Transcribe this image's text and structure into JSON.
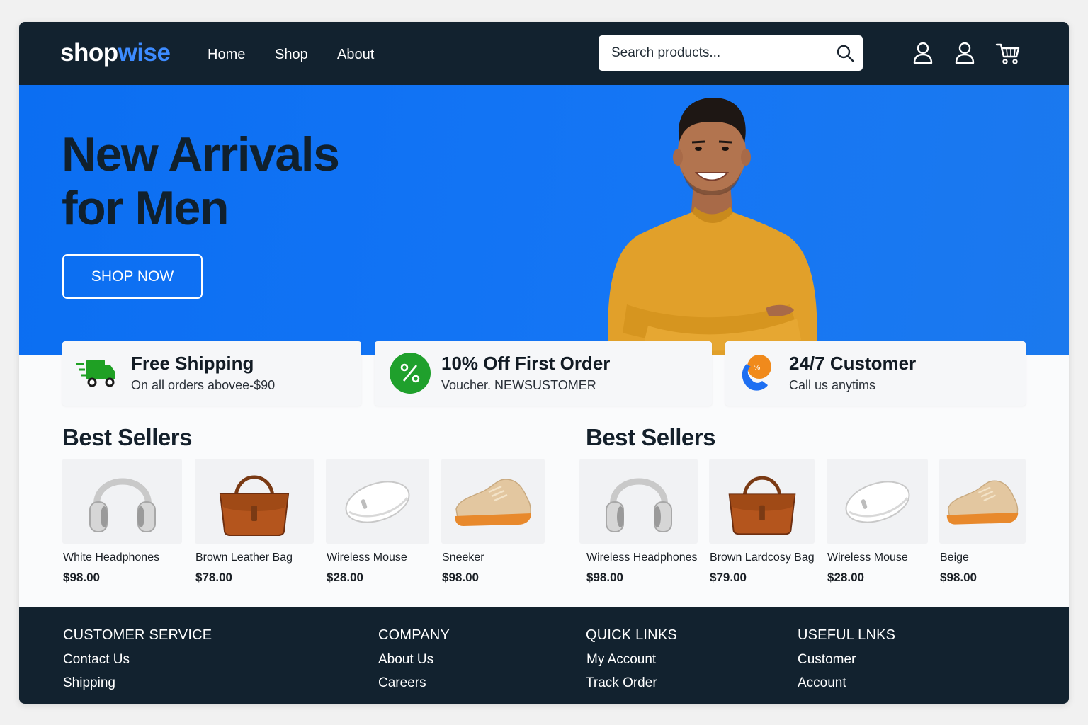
{
  "header": {
    "logo_main": "shop",
    "logo_accent": "wise",
    "nav": [
      "Home",
      "Shop",
      "About"
    ],
    "search_placeholder": "Search products..."
  },
  "hero": {
    "title_line1": "New Arrivals",
    "title_line2": "for Men",
    "cta_label": "SHOP NOW"
  },
  "features": [
    {
      "title": "Free Shipping",
      "subtitle": "On all orders abovee-$90",
      "icon": "delivery-truck-icon",
      "color": "#1fa024"
    },
    {
      "title": "10% Off First Order",
      "subtitle": "Voucher. NEWSUSTOMER",
      "icon": "percent-badge-icon",
      "color": "#1fa02c"
    },
    {
      "title": "24/7 Customer",
      "subtitle": "Call us anytims",
      "icon": "support-phone-icon",
      "color": "#f08a1c"
    }
  ],
  "best_sellers": [
    {
      "title": "Best Sellers",
      "products": [
        {
          "name": "White Headphones",
          "price": "$98.00",
          "icon": "headphones-image"
        },
        {
          "name": "Brown Leather Bag",
          "price": "$78.00",
          "icon": "leather-bag-image"
        },
        {
          "name": "Wireless Mouse",
          "price": "$28.00",
          "icon": "mouse-image"
        },
        {
          "name": "Sneeker",
          "price": "$98.00",
          "icon": "sneaker-image"
        }
      ]
    },
    {
      "title": "Best Sellers",
      "products": [
        {
          "name": "Wireless Headphones",
          "price": "$98.00",
          "icon": "headphones-image"
        },
        {
          "name": "Brown Lardcosy Bag",
          "price": "$79.00",
          "icon": "leather-bag-image"
        },
        {
          "name": "Wireless Mouse",
          "price": "$28.00",
          "icon": "mouse-image"
        },
        {
          "name": "Beige",
          "price": "$98.00",
          "icon": "sneaker-image"
        }
      ]
    }
  ],
  "footer": [
    {
      "heading": "CUSTOMER SERVICE",
      "links": [
        "Contact Us",
        "Shipping"
      ]
    },
    {
      "heading": "COMPANY",
      "links": [
        "About Us",
        "Careers"
      ]
    },
    {
      "heading": "QUICK LINKS",
      "links": [
        "My Account",
        "Track Order"
      ]
    },
    {
      "heading": "USEFUL LNKS",
      "links": [
        "Customer",
        "Account"
      ]
    }
  ],
  "colors": {
    "nav_bg": "#12222f",
    "hero_blue": "#1274f3",
    "logo_accent": "#3d8bff",
    "sweater": "#e1a02a"
  }
}
